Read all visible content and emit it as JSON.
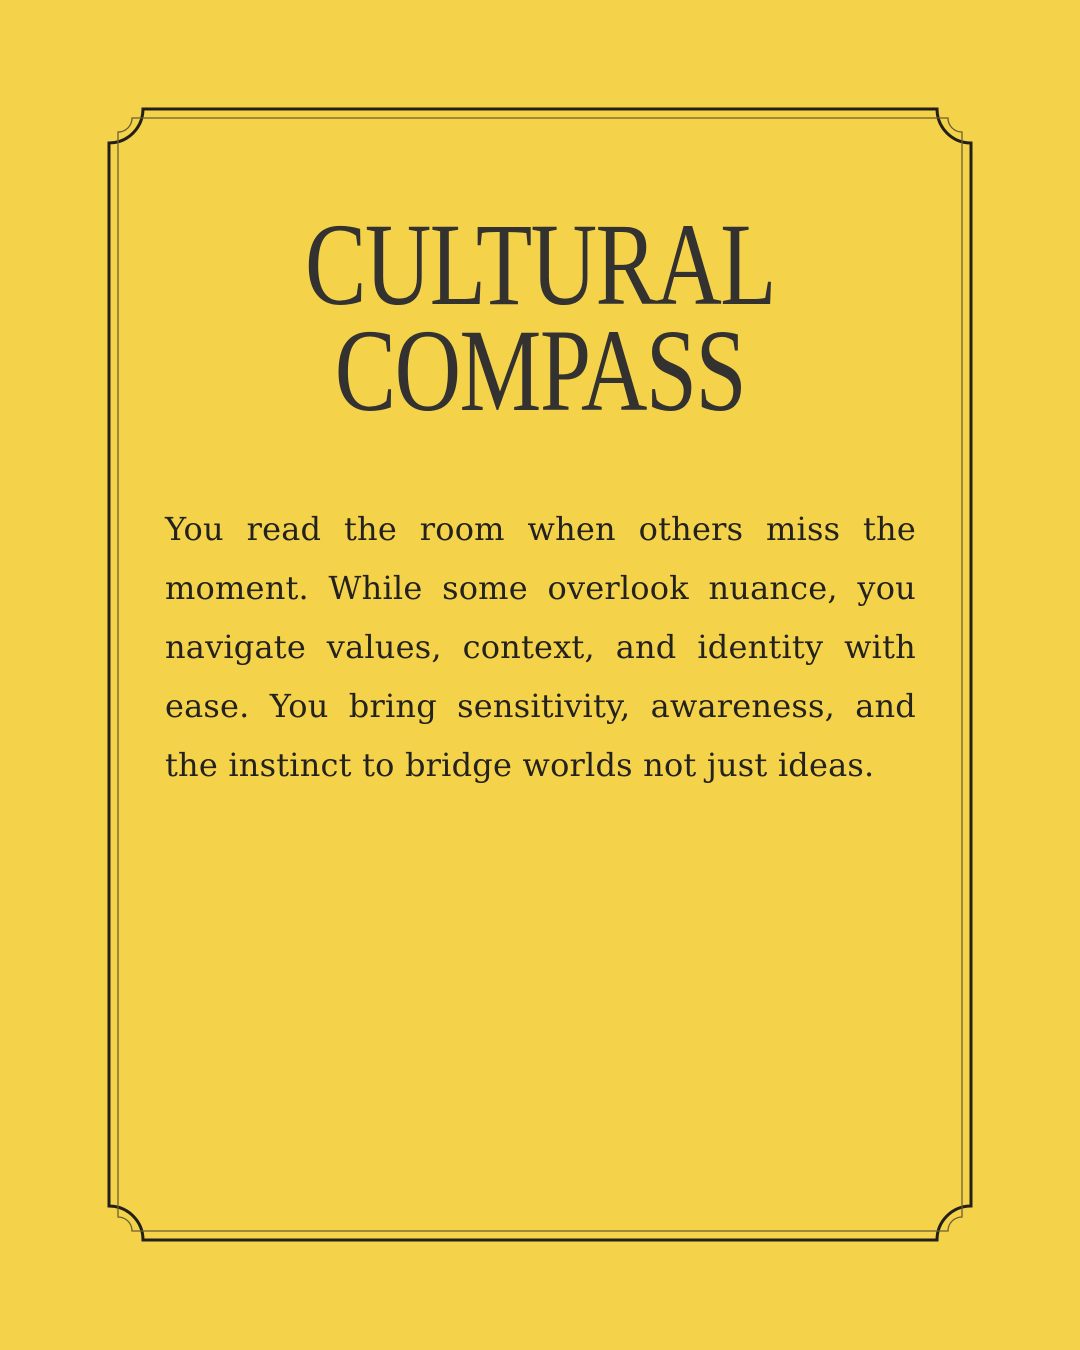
{
  "title": {
    "line1": "CULTURAL",
    "line2": "COMPASS"
  },
  "body": "You read the room when others miss the moment. While some overlook nuance, you navigate values, context, and identity with ease. You bring sensitivity, awareness, and the instinct to bridge worlds not just ideas.",
  "colors": {
    "background": "#f4d34b",
    "frame": "#231f1a",
    "text": "#333231"
  }
}
